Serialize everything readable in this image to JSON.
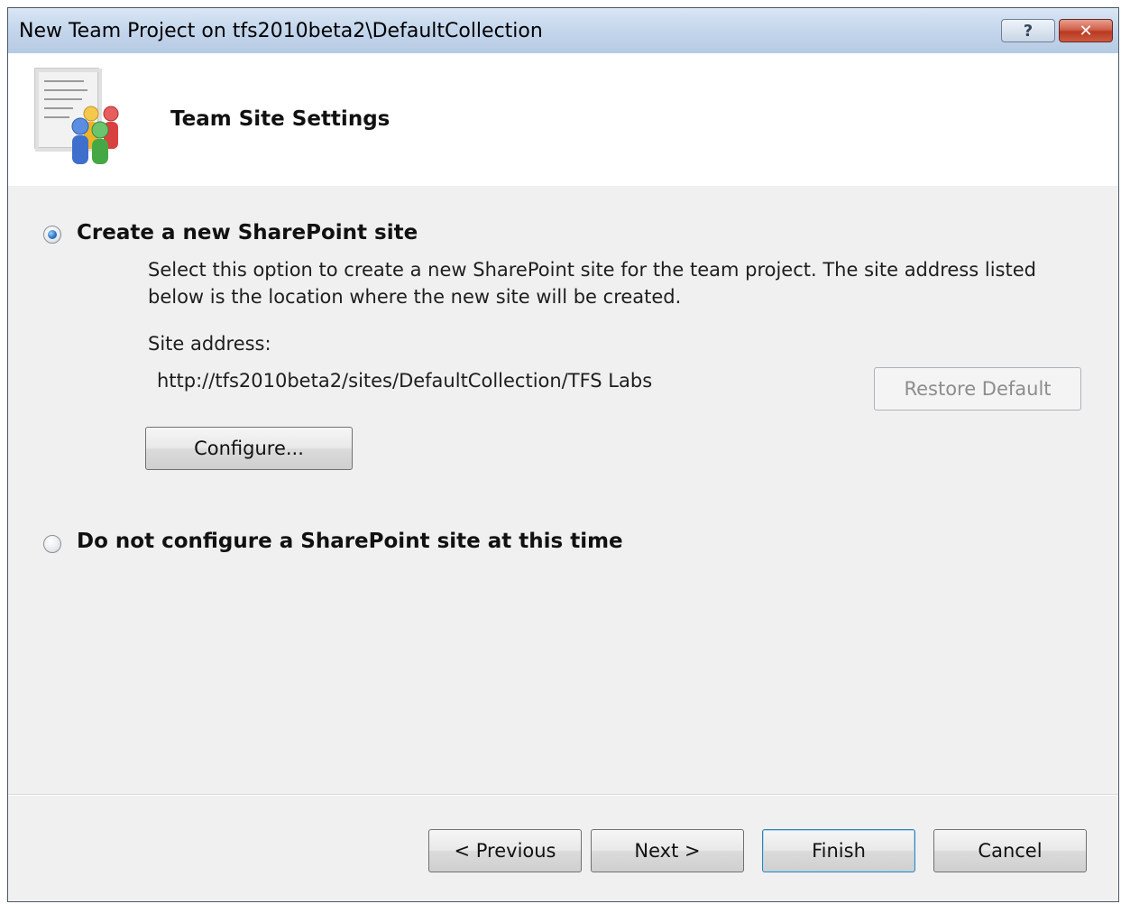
{
  "window": {
    "title": "New Team Project on tfs2010beta2\\DefaultCollection",
    "help_label": "?",
    "close_label": "✕"
  },
  "header": {
    "title": "Team Site Settings",
    "icon": "team-project-icon"
  },
  "options": {
    "create": {
      "label": "Create a new SharePoint site",
      "selected": true,
      "description": "Select this option to create a new SharePoint site for the team project. The site address listed below is the location where the new site will be created.",
      "site_address_label": "Site address:",
      "site_address_value": "http://tfs2010beta2/sites/DefaultCollection/TFS Labs",
      "restore_default_label": "Restore Default",
      "configure_label": "Configure..."
    },
    "none": {
      "label": "Do not configure a SharePoint site at this time",
      "selected": false
    }
  },
  "footer": {
    "previous_label": "< Previous",
    "next_label": "Next >",
    "finish_label": "Finish",
    "cancel_label": "Cancel"
  }
}
